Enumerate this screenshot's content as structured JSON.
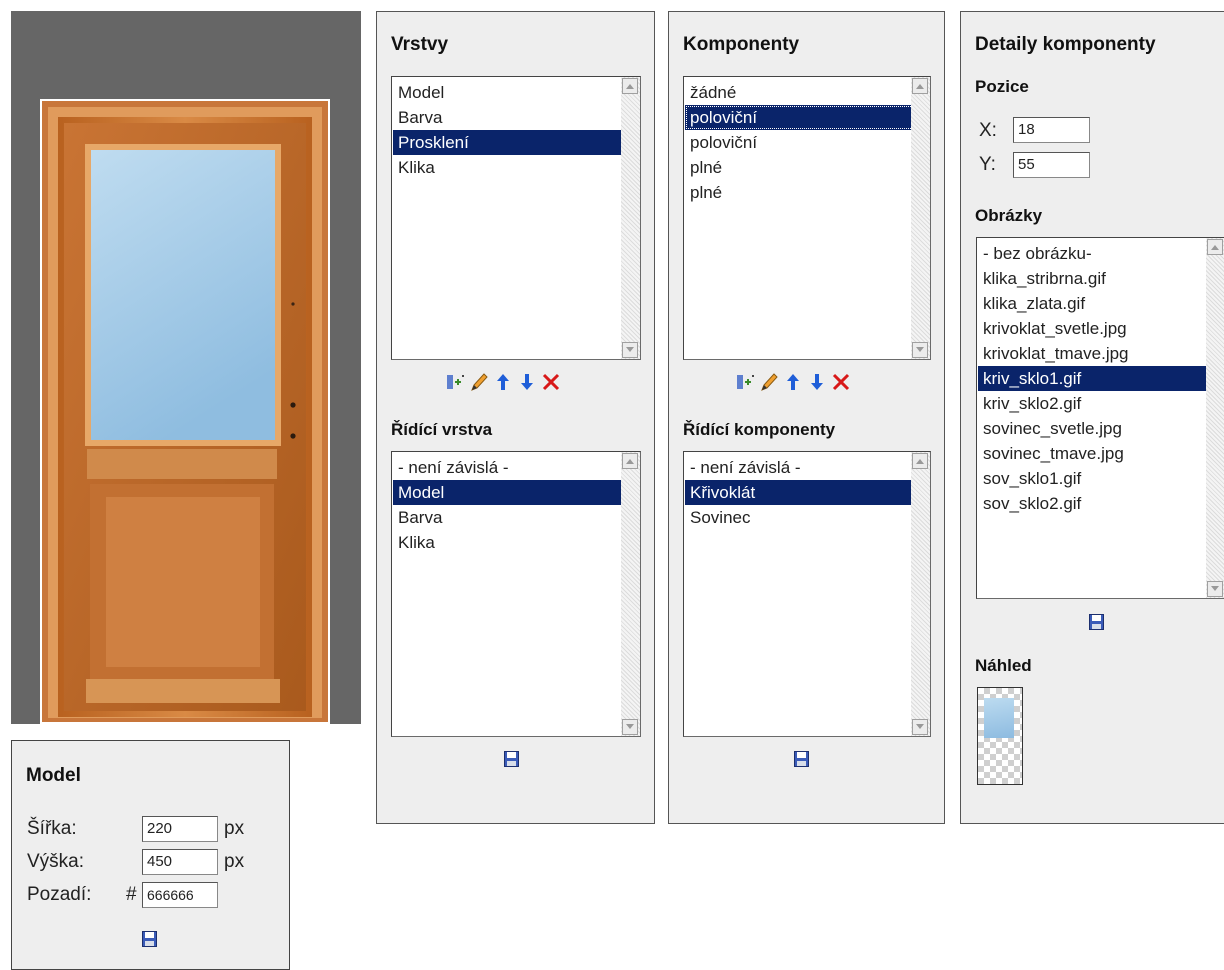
{
  "canvas": {
    "background": "#666666"
  },
  "layers": {
    "title": "Vrstvy",
    "items": [
      "Model",
      "Barva",
      "Prosklení",
      "Klika"
    ],
    "selected": 2
  },
  "controlling_layer": {
    "title": "Řídící vrstva",
    "items": [
      "- není závislá -",
      "Model",
      "Barva",
      "Klika"
    ],
    "selected": 1
  },
  "components": {
    "title": "Komponenty",
    "items": [
      "žádné",
      "poloviční",
      "poloviční",
      "plné",
      "plné"
    ],
    "selected": 1
  },
  "controlling_components": {
    "title": "Řídící komponenty",
    "items": [
      "- není závislá -",
      "Křivoklát",
      "Sovinec"
    ],
    "selected": 1
  },
  "details": {
    "title": "Detaily komponenty",
    "position_title": "Pozice",
    "x_label": "X:",
    "x_value": "18",
    "y_label": "Y:",
    "y_value": "55",
    "images_title": "Obrázky",
    "images": [
      "- bez obrázku-",
      "klika_stribrna.gif",
      "klika_zlata.gif",
      "krivoklat_svetle.jpg",
      "krivoklat_tmave.jpg",
      "kriv_sklo1.gif",
      "kriv_sklo2.gif",
      "sovinec_svetle.jpg",
      "sovinec_tmave.jpg",
      "sov_sklo1.gif",
      "sov_sklo2.gif"
    ],
    "images_selected": 5,
    "preview_title": "Náhled"
  },
  "model": {
    "title": "Model",
    "width_label": "Šířka:",
    "width_value": "220",
    "height_label": "Výška:",
    "height_value": "450",
    "unit": "px",
    "background_label": "Pozadí:",
    "hash": "#",
    "background_value": "666666"
  },
  "icons": {
    "toolbar": [
      "add-icon",
      "edit-pencil-icon",
      "move-up-arrow-icon",
      "move-down-arrow-icon",
      "delete-x-icon"
    ],
    "save": "save-disk-icon"
  }
}
